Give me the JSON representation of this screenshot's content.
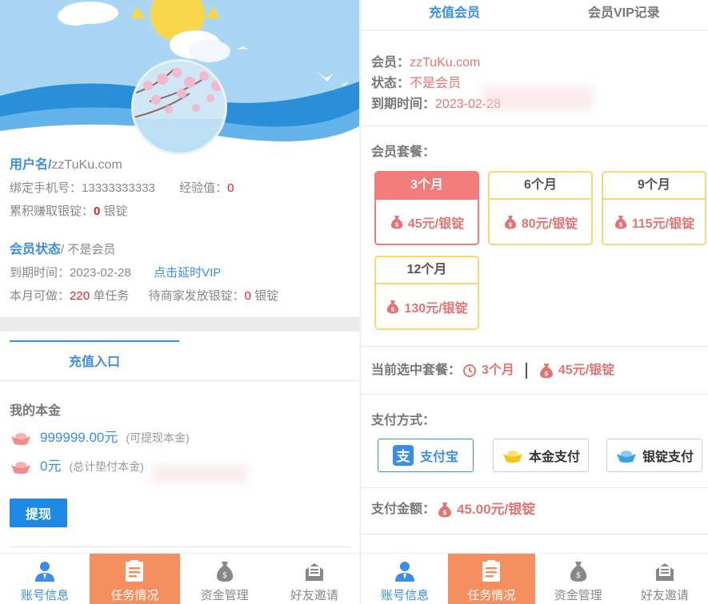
{
  "left": {
    "user": {
      "username_label": "用户名/",
      "username": "zzTuKu.com",
      "phone_label": "绑定手机号：",
      "phone": "13333333333",
      "exp_label": "经验值：",
      "exp": "0",
      "earned_label": "累积赚取银锭：",
      "earned": "0",
      "earned_unit": "银锭"
    },
    "member": {
      "status_label": "会员状态",
      "status": "/ 不是会员",
      "expire_label": "到期时间：",
      "expire": "2023-02-28",
      "extend_link": "点击延时VIP",
      "monthly_label": "本月可做：",
      "monthly_count": "220",
      "monthly_unit": "单任务",
      "pending_label": "待商家发放银锭：",
      "pending": "0",
      "pending_unit": "银锭"
    },
    "tab_recharge": "充值入口",
    "principal": {
      "title": "我的本金",
      "items": [
        {
          "amount": "999999.00元",
          "note": "(可提现本金)"
        },
        {
          "amount": "0元",
          "note": "(总计垫付本金)"
        }
      ],
      "withdraw_button": "提现"
    }
  },
  "right": {
    "tabs": [
      "充值会员",
      "会员VIP记录"
    ],
    "member_info": {
      "member_label": "会员：",
      "member": "zzTuKu.com",
      "status_label": "状态：",
      "status": "不是会员",
      "expire_label": "到期时间：",
      "expire": "2023-02-28"
    },
    "packages_title": "会员套餐：",
    "packages": [
      {
        "duration": "3个月",
        "price": "45元/银锭",
        "selected": true
      },
      {
        "duration": "6个月",
        "price": "80元/银锭",
        "selected": false
      },
      {
        "duration": "9个月",
        "price": "115元/银锭",
        "selected": false
      },
      {
        "duration": "12个月",
        "price": "130元/银锭",
        "selected": false
      }
    ],
    "current": {
      "label": "当前选中套餐：",
      "duration": "3个月",
      "price": "45元/银锭"
    },
    "pay_method_title": "支付方式：",
    "pay_methods": {
      "alipay": "支付宝",
      "principal": "本金支付",
      "ingot": "银锭支付"
    },
    "pay_amount": {
      "label": "支付金额：",
      "value": "45.00元/银锭"
    }
  },
  "nav": {
    "items": [
      {
        "label": "账号信息",
        "icon": "user-icon"
      },
      {
        "label": "任务情况",
        "icon": "document-icon"
      },
      {
        "label": "资金管理",
        "icon": "money-bag-icon"
      },
      {
        "label": "好友邀请",
        "icon": "invite-icon"
      }
    ],
    "active_index": 1
  },
  "colors": {
    "accent_blue": "#3a8ee6",
    "active_orange": "#f58f5f",
    "price_red": "#e57373",
    "selected_pkg": "#f27b7b",
    "pkg_border": "#f6d972"
  }
}
